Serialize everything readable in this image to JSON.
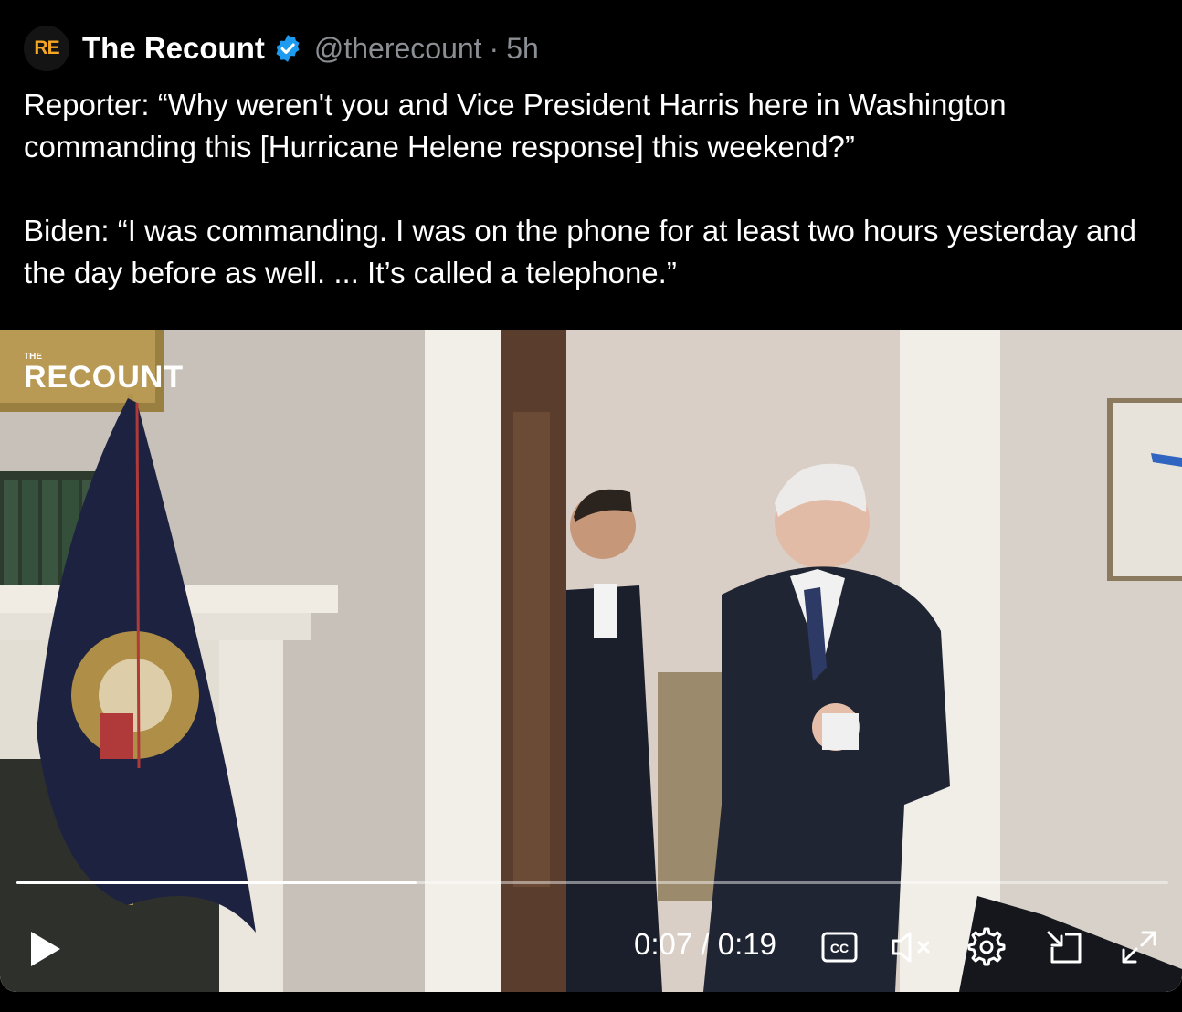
{
  "tweet": {
    "avatar_text": "RE",
    "author": "The Recount",
    "handle": "@therecount",
    "separator": "·",
    "time": "5h",
    "text_line1": "Reporter: “Why weren't you and Vice President Harris here in Washington commanding this [Hurricane Helene response] this weekend?”",
    "text_line2": "Biden: “I was commanding. I was on the phone for at least two hours yesterday and the day before as well. ... It’s called a telephone.”"
  },
  "video": {
    "watermark_small": "THE",
    "watermark_large": "RECOUNT",
    "progress_fraction": 0.347,
    "time_display": "0:07 / 0:19"
  },
  "colors": {
    "background": "#000000",
    "text": "#ffffff",
    "muted": "#8b8f94",
    "verified": "#1d9bf0",
    "avatar_accent": "#f5a623"
  },
  "icons": {
    "verified": "verified-badge-icon",
    "play": "play-icon",
    "cc": "closed-captions-icon",
    "mute": "muted-speaker-icon",
    "settings": "gear-icon",
    "pip": "picture-in-picture-icon",
    "fullscreen": "expand-icon"
  }
}
